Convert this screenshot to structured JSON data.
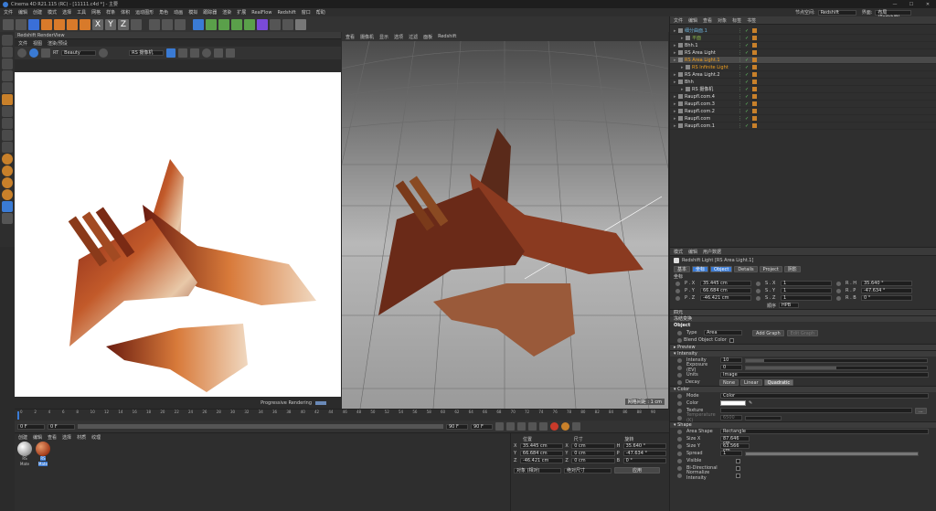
{
  "window": {
    "title": "Cinema 4D R21.115 (RC) - [11111.c4d *] - 主要"
  },
  "menubar": [
    "文件",
    "编辑",
    "创建",
    "模式",
    "选择",
    "工具",
    "网格",
    "样条",
    "体积",
    "运动图形",
    "角色",
    "动画",
    "模拟",
    "跟踪器",
    "渲染",
    "扩展",
    "RealFlow",
    "Redshift",
    "窗口",
    "帮助"
  ],
  "layout": {
    "label": "界面:",
    "value": "布局 (Redshift)",
    "node_label": "节点空间:",
    "node_value": "Redshift"
  },
  "render_view": {
    "title": "Redshift RenderView",
    "menu": [
      "文件",
      "视图",
      "渲染/预设"
    ],
    "mode": "Beauty",
    "camera": "RS 摄像机",
    "status": "Progressive Rendering"
  },
  "viewport": {
    "menu": [
      "查看",
      "摄像机",
      "显示",
      "选项",
      "过滤",
      "面板",
      "Redshift"
    ],
    "grid_label": "网格间距 : 1 cm"
  },
  "object_manager": {
    "menu": [
      "文件",
      "编辑",
      "查看",
      "对象",
      "标签",
      "书签"
    ],
    "objects": [
      {
        "name": "细分曲面.1",
        "color": "#6ab0d8",
        "indent": 0
      },
      {
        "name": "平面",
        "color": "#8ab84a",
        "indent": 1
      },
      {
        "name": "Bhh.1",
        "color": "#ddd",
        "indent": 0
      },
      {
        "name": "RS Area Light",
        "color": "#ddd",
        "indent": 0
      },
      {
        "name": "RS Area Light.1",
        "color": "#f0a020",
        "indent": 0,
        "selected": true
      },
      {
        "name": "RS Infinite Light",
        "color": "#f0a020",
        "indent": 1
      },
      {
        "name": "RS Area Light.2",
        "color": "#ddd",
        "indent": 0
      },
      {
        "name": "Bhh",
        "color": "#ddd",
        "indent": 0
      },
      {
        "name": "RS 摄像机",
        "color": "#ddd",
        "indent": 1
      },
      {
        "name": "Raupfl.com.4",
        "color": "#ddd",
        "indent": 0
      },
      {
        "name": "Raupfl.com.3",
        "color": "#ddd",
        "indent": 0
      },
      {
        "name": "Raupfl.com.2",
        "color": "#ddd",
        "indent": 0
      },
      {
        "name": "Raupfl.com",
        "color": "#ddd",
        "indent": 0
      },
      {
        "name": "Raupfl.com.1",
        "color": "#ddd",
        "indent": 0
      }
    ]
  },
  "attr": {
    "menu": [
      "模式",
      "编辑",
      "用户数据"
    ],
    "title": "Redshift Light [RS Area Light.1]",
    "tabs": [
      "基本",
      "坐标",
      "Object",
      "Details",
      "Project",
      "阴影"
    ],
    "coord": {
      "label": "坐标",
      "rows": [
        {
          "p": "P . X",
          "pv": "35.445 cm",
          "s": "S . X",
          "sv": "1",
          "r": "R . H",
          "rv": "35.640 °"
        },
        {
          "p": "P . Y",
          "pv": "66.684 cm",
          "s": "S . Y",
          "sv": "1",
          "r": "R . P",
          "rv": "-47.634 °"
        },
        {
          "p": "P . Z",
          "pv": "-46.421 cm",
          "s": "S . Z",
          "sv": "1",
          "r": "R . B",
          "rv": "0 °"
        }
      ],
      "order_label": "顺序",
      "order_value": "HPB",
      "freeze": "四元",
      "freeze2": "冻结变换"
    },
    "object": {
      "label": "Object",
      "type_label": "Type",
      "type_value": "Area",
      "add_graph": "Add Graph",
      "edit_graph": "Edit Graph",
      "blend_label": "Blend Object Color",
      "preview": "▸ Preview"
    },
    "intensity": {
      "label": "▾ Intensity",
      "intensity_label": "Intensity",
      "intensity_value": "10",
      "exposure_label": "Exposure (EV)",
      "exposure_value": "0",
      "units_label": "Units",
      "units_value": "Image",
      "decay_label": "Decay",
      "decay_options": [
        "None",
        "Linear",
        "Quadratic"
      ]
    },
    "color": {
      "label": "▾ Color",
      "mode_label": "Mode",
      "mode_value": "Color",
      "color_label": "Color",
      "texture_label": "Texture",
      "temp_label": "Temperature (K)",
      "temp_value": "6500"
    },
    "shape": {
      "label": "▾ Shape",
      "area_label": "Area Shape",
      "area_value": "Rectangle",
      "sizex_label": "Size X",
      "sizex_value": "87.646 cm",
      "sizey_label": "Size Y",
      "sizey_value": "63.566 cm",
      "spread_label": "Spread",
      "spread_value": "1",
      "visible_label": "Visible",
      "bidir_label": "Bi-Directional",
      "norm_label": "Normalize Intensity"
    }
  },
  "timeline": {
    "ticks": [
      "0",
      "2",
      "4",
      "6",
      "8",
      "10",
      "12",
      "14",
      "16",
      "18",
      "20",
      "22",
      "24",
      "26",
      "28",
      "30",
      "32",
      "34",
      "36",
      "38",
      "40",
      "42",
      "44",
      "46",
      "48",
      "50",
      "52",
      "54",
      "56",
      "58",
      "60",
      "62",
      "64",
      "66",
      "68",
      "70",
      "72",
      "74",
      "76",
      "78",
      "80",
      "82",
      "84",
      "86",
      "88",
      "90"
    ],
    "frame": "0 F",
    "start": "0 F",
    "end": "90 F",
    "end2": "90 F",
    "cur": "0 F"
  },
  "materials": {
    "menu": [
      "创建",
      "编辑",
      "查看",
      "选择",
      "材质",
      "纹理"
    ],
    "items": [
      "RS Mate",
      "RS Mate"
    ]
  },
  "coord_manager": {
    "headers": [
      "位置",
      "尺寸",
      "旋转"
    ],
    "rows": [
      {
        "a": "X",
        "av": "35.445 cm",
        "b": "X",
        "bv": "0 cm",
        "c": "H",
        "cv": "35.640 °"
      },
      {
        "a": "Y",
        "av": "66.684 cm",
        "b": "Y",
        "bv": "0 cm",
        "c": "P",
        "cv": "-47.634 °"
      },
      {
        "a": "Z",
        "av": "-46.421 cm",
        "b": "Z",
        "bv": "0 cm",
        "c": "B",
        "cv": "0 °"
      }
    ],
    "mode1": "对象 (相对)",
    "mode2": "绝对尺寸",
    "apply": "应用"
  }
}
